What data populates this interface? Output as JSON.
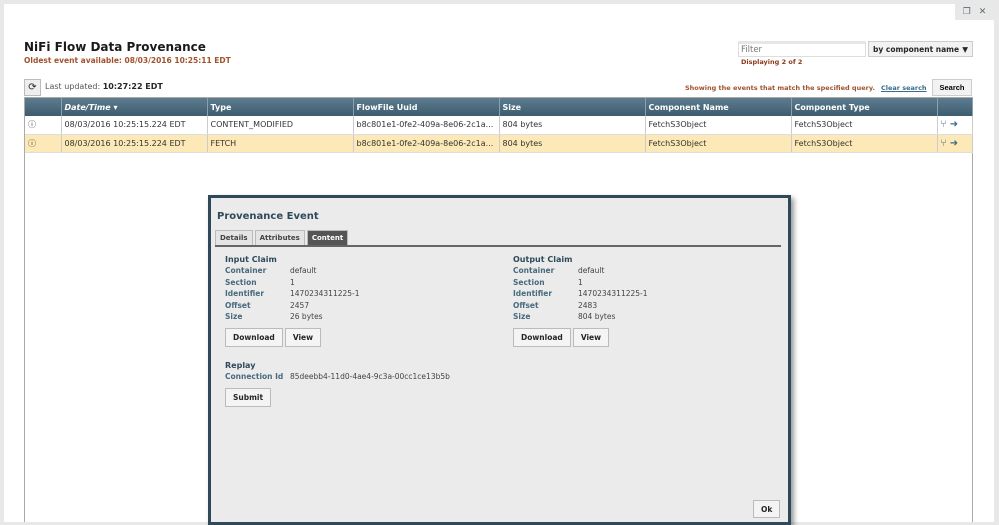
{
  "window": {
    "restore_icon": "restore-icon",
    "close_icon": "close-icon"
  },
  "header": {
    "title": "NiFi Flow Data Provenance",
    "oldest": "Oldest event available: 08/03/2016 10:25:11 EDT",
    "last_updated_label": "Last updated:",
    "last_updated_value": "10:27:22 EDT"
  },
  "filter": {
    "placeholder": "Filter",
    "mode": "by component name",
    "displaying": "Displaying 2 of 2"
  },
  "query": {
    "message": "Showing the events that match the specified query.",
    "clear": "Clear search",
    "search": "Search"
  },
  "table": {
    "columns": [
      "",
      "Date/Time",
      "Type",
      "FlowFile Uuid",
      "Size",
      "Component Name",
      "Component Type",
      ""
    ],
    "rows": [
      {
        "date": "08/03/2016 10:25:15.224 EDT",
        "type": "CONTENT_MODIFIED",
        "uuid": "b8c801e1-0fe2-409a-8e06-2c1a...",
        "size": "804 bytes",
        "name": "FetchS3Object",
        "ctype": "FetchS3Object"
      },
      {
        "date": "08/03/2016 10:25:15.224 EDT",
        "type": "FETCH",
        "uuid": "b8c801e1-0fe2-409a-8e06-2c1a...",
        "size": "804 bytes",
        "name": "FetchS3Object",
        "ctype": "FetchS3Object",
        "selected": true
      }
    ]
  },
  "dialog": {
    "title": "Provenance Event",
    "tabs": [
      "Details",
      "Attributes",
      "Content"
    ],
    "active_tab": "Content",
    "labels": {
      "container": "Container",
      "section": "Section",
      "identifier": "Identifier",
      "offset": "Offset",
      "size": "Size"
    },
    "input": {
      "title": "Input Claim",
      "container": "default",
      "section": "1",
      "identifier": "1470234311225-1",
      "offset": "2457",
      "size": "26 bytes"
    },
    "output": {
      "title": "Output Claim",
      "container": "default",
      "section": "1",
      "identifier": "1470234311225-1",
      "offset": "2483",
      "size": "804 bytes"
    },
    "download": "Download",
    "view": "View",
    "replay": {
      "title": "Replay",
      "label": "Connection Id",
      "value": "85deebb4-11d0-4ae4-9c3a-00cc1ce13b5b",
      "submit": "Submit"
    },
    "ok": "Ok"
  }
}
